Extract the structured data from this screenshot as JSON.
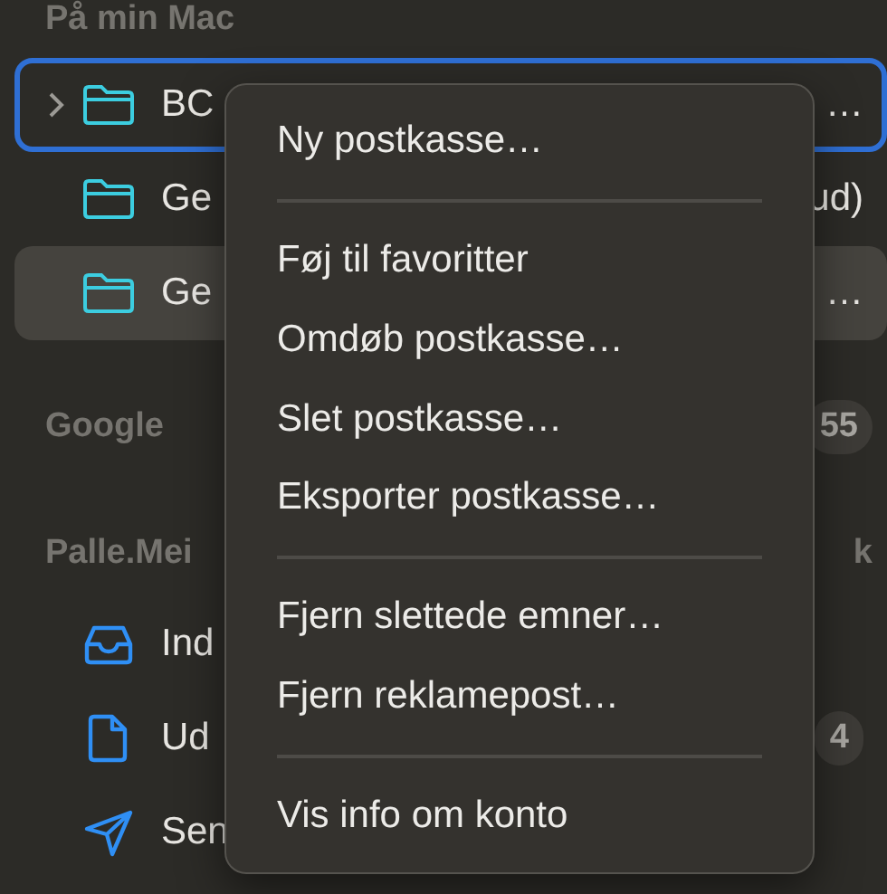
{
  "sidebar": {
    "sections": [
      {
        "title": "På min Mac",
        "items": [
          {
            "kind": "folder",
            "label": "BC",
            "trailing": "…",
            "expanded": false,
            "focused": true,
            "selected": false
          },
          {
            "kind": "folder",
            "label": "Ge",
            "trailing": "ud)",
            "focused": false,
            "selected": false
          },
          {
            "kind": "folder",
            "label": "Ge",
            "trailing": "…",
            "focused": false,
            "selected": true
          }
        ]
      },
      {
        "title": "Google",
        "badge": "55"
      },
      {
        "title": "Palle.Mei",
        "trailing": "k",
        "items": [
          {
            "kind": "inbox",
            "label": "Ind",
            "focused": false,
            "selected": false
          },
          {
            "kind": "document",
            "label": "Ud",
            "badge": "4",
            "focused": false,
            "selected": false
          },
          {
            "kind": "send",
            "label": "Sen",
            "focused": false,
            "selected": false
          }
        ]
      }
    ]
  },
  "context_menu": {
    "groups": [
      [
        "Ny postkasse…"
      ],
      [
        "Føj til favoritter",
        "Omdøb postkasse…",
        "Slet postkasse…",
        "Eksporter postkasse…"
      ],
      [
        "Fjern slettede emner…",
        "Fjern reklamepost…"
      ],
      [
        "Vis info om konto"
      ]
    ]
  }
}
